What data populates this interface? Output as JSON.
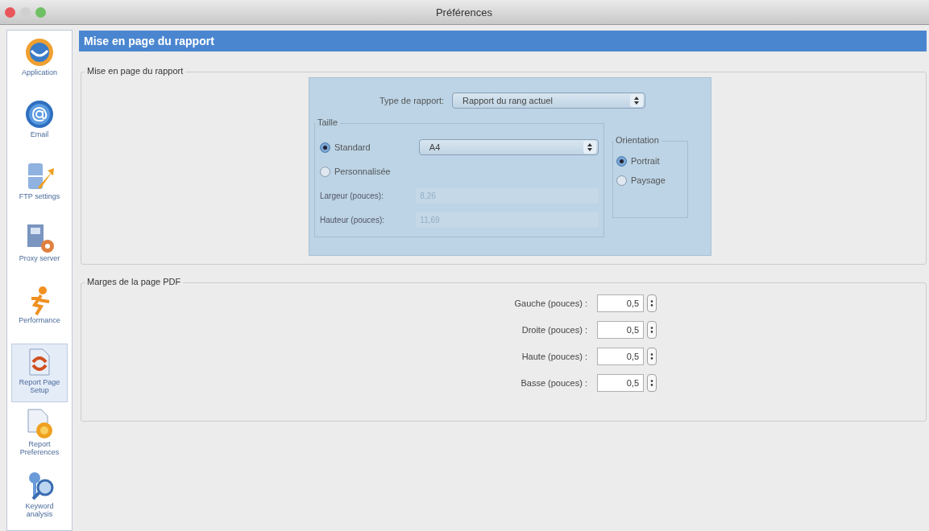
{
  "window": {
    "title": "Préférences"
  },
  "sidebar": {
    "items": [
      {
        "label": "Application",
        "selected": false
      },
      {
        "label": "Email",
        "selected": false
      },
      {
        "label": "FTP settings",
        "selected": false
      },
      {
        "label": "Proxy server",
        "selected": false
      },
      {
        "label": "Performance",
        "selected": false
      },
      {
        "label": "Report Page Setup",
        "selected": true
      },
      {
        "label": "Report Preferences",
        "selected": false
      },
      {
        "label": "Keyword analysis",
        "selected": false
      }
    ]
  },
  "header": {
    "title": "Mise en page du rapport"
  },
  "layout_group": {
    "legend": "Mise en page du rapport",
    "report_type": {
      "label": "Type de rapport:",
      "value": "Rapport du rang actuel"
    },
    "size": {
      "legend": "Taille",
      "options": [
        {
          "label": "Standard",
          "selected": true
        },
        {
          "label": "Personnalisée",
          "selected": false
        }
      ],
      "standard_value": "A4",
      "fields": [
        {
          "label": "Largeur (pouces):",
          "value": "8,26",
          "disabled": true
        },
        {
          "label": "Hauteur (pouces):",
          "value": "11,69",
          "disabled": true
        }
      ]
    },
    "orientation": {
      "legend": "Orientation",
      "options": [
        {
          "label": "Portrait",
          "selected": true
        },
        {
          "label": "Paysage",
          "selected": false
        }
      ]
    }
  },
  "margins_group": {
    "legend": "Marges de la page PDF",
    "fields": [
      {
        "label": "Gauche (pouces) :",
        "value": "0,5"
      },
      {
        "label": "Droite (pouces) :",
        "value": "0,5"
      },
      {
        "label": "Haute (pouces) :",
        "value": "0,5"
      },
      {
        "label": "Basse (pouces) :",
        "value": "0,5"
      }
    ]
  }
}
